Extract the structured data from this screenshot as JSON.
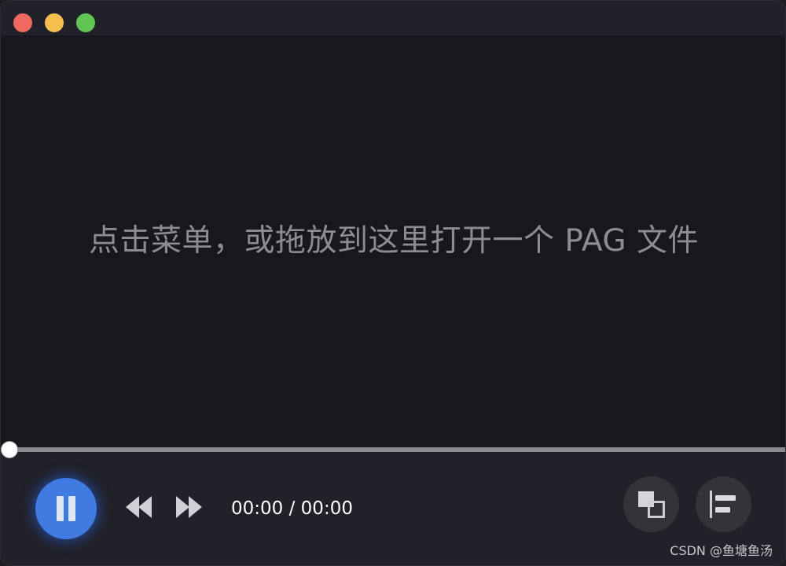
{
  "stage": {
    "hint_text": "点击菜单，或拖放到这里打开一个 PAG 文件"
  },
  "player": {
    "progress": 0,
    "current_time": "00:00",
    "separator": " / ",
    "total_time": "00:00",
    "state": "playing"
  },
  "icons": {
    "play_pause": "pause-icon",
    "rewind": "rewind-icon",
    "fast_forward": "fast-forward-icon",
    "layers": "layers-icon",
    "align": "align-left-icon"
  },
  "colors": {
    "accent": "#3f7be0",
    "background": "#18171d",
    "control_bar": "#212129",
    "hint_text": "#8c8c92"
  },
  "watermark": {
    "text": "CSDN @鱼塘鱼汤"
  }
}
